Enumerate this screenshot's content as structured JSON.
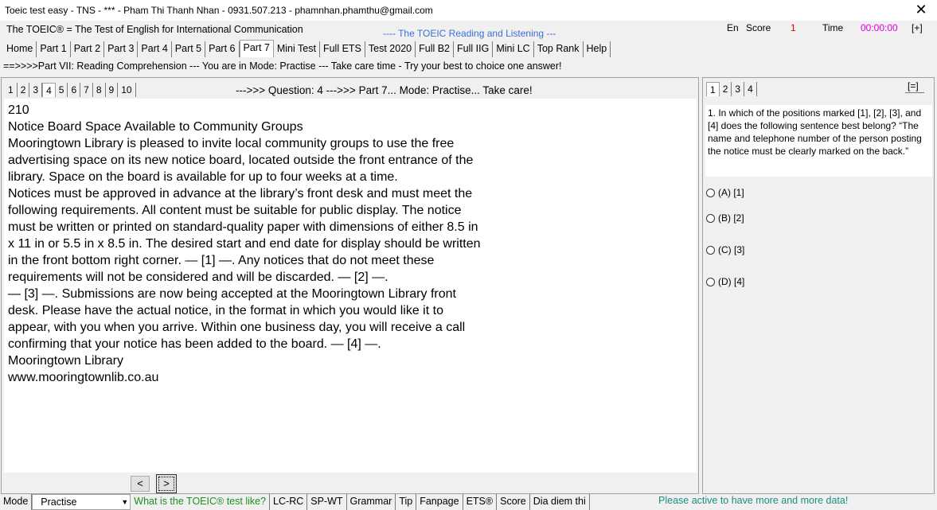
{
  "window": {
    "title": "Toeic test easy - TNS - *** - Pham Thi Thanh Nhan - 0931.507.213 - phamnhan.phamthu@gmail.com",
    "close_glyph": "✕"
  },
  "header": {
    "brand": "The TOEIC® = The Test of English for International Communication",
    "subtitle": "---- The TOEIC Reading and Listening ---",
    "lang": "En",
    "score_label": "Score",
    "score_value": "1",
    "time_label": "Time",
    "time_value": "00:00:00",
    "plus": "[+]",
    "colors": {
      "subtitle": "#3a6fd8",
      "score": "#e00000",
      "time": "#e000e0"
    }
  },
  "menu": {
    "items": [
      "Home",
      "Part 1",
      "Part 2",
      "Part 3",
      "Part 4",
      "Part 5",
      "Part 6",
      "Part 7",
      "Mini Test",
      "Full ETS",
      "Test 2020",
      "Full B2",
      "Full IIG",
      "Mini LC",
      "Top Rank",
      "Help"
    ],
    "active": "Part 7"
  },
  "mode_line": "==>>>>Part VII: Reading Comprehension --- You are in Mode: Practise --- Take care time - Try your best to choice one answer!",
  "left": {
    "tabs": [
      "1",
      "2",
      "3",
      "4",
      "5",
      "6",
      "7",
      "8",
      "9",
      "10"
    ],
    "active_tab": "4",
    "question_info": "--->>> Question: 4 --->>> Part 7... Mode: Practise... Take care!",
    "passage_lines": [
      "210",
      "Notice Board Space Available to Community Groups",
      "Mooringtown Library is pleased to invite local community groups to use the free",
      "advertising space on its new notice board, located outside the front entrance of the",
      "library. Space on the board is available for up to four weeks at a time.",
      "Notices must be approved in advance at the library’s front desk and must meet the",
      "following requirements. All content must be suitable for public display. The notice",
      "must be written or printed on standard-quality paper with dimensions of either 8.5 in",
      "x 11 in or 5.5 in x 8.5 in. The desired start and end date for display should be written",
      "in the front bottom right corner. — [1] —. Any notices that do not meet these",
      "requirements will not be considered and will be discarded. — [2] —.",
      "— [3] —. Submissions are now being accepted at the Mooringtown Library front",
      "desk. Please have the actual notice, in the format in which you would like it to",
      "appear, with you when you arrive. Within one business day, you will receive a call",
      "confirming that your notice has been added to the board. — [4] —.",
      "Mooringtown Library",
      "www.mooringtownlib.co.au"
    ],
    "prev_label": "<",
    "next_label": ">"
  },
  "right": {
    "tabs": [
      "1",
      "2",
      "3",
      "4"
    ],
    "active_tab": "1",
    "expand_label": "[=]",
    "question": "1. In which of the positions marked [1], [2], [3], and [4] does the following sentence best belong? “The name and telephone number of the person posting the notice must be clearly marked on the back.”",
    "options": [
      "(A) [1]",
      "(B) [2]",
      "(C) [3]",
      "(D) [4]"
    ]
  },
  "status": {
    "mode_label": "Mode",
    "mode_value": "Practise",
    "items": [
      "What is the TOEIC® test like?",
      "LC-RC",
      "SP-WT",
      "Grammar",
      "Tip",
      "Fanpage",
      "ETS®",
      "Score",
      "Dia diem thi"
    ],
    "notice": "Please active to have more and more data!",
    "colors": {
      "link_green": "#1f8f1f",
      "notice": "#1b8f7f"
    }
  }
}
